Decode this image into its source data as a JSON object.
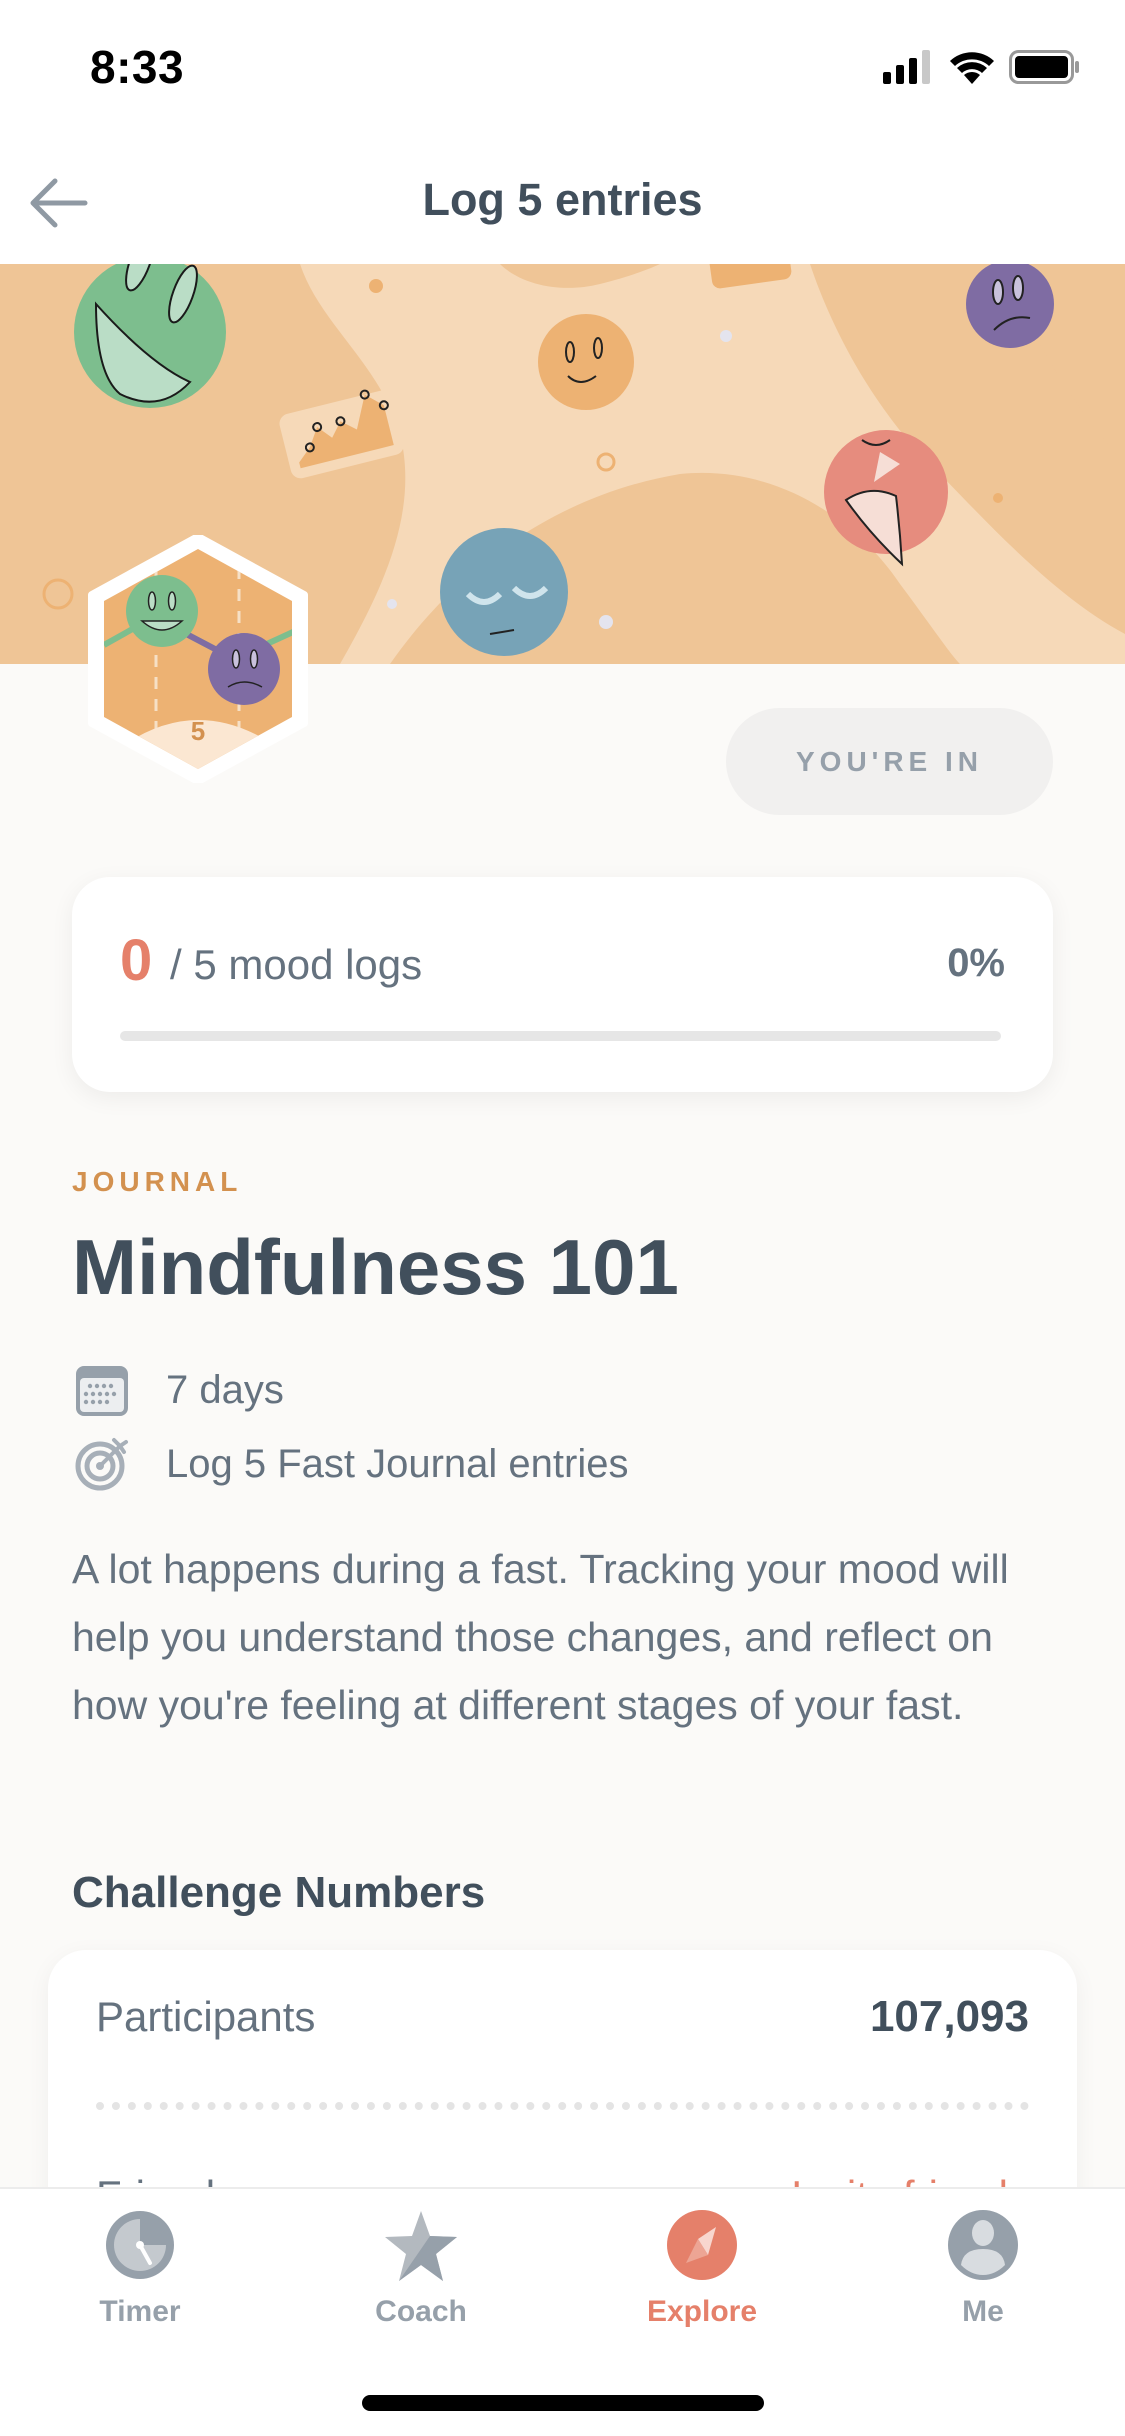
{
  "status_bar": {
    "time": "8:33",
    "icons": [
      "cellular-signal-icon",
      "wifi-icon",
      "battery-icon"
    ]
  },
  "nav": {
    "back_icon": "arrow-left-icon",
    "title": "Log 5 entries"
  },
  "hero": {
    "illustration": "mood-faces-illustration",
    "badge_number": "5"
  },
  "join_button": {
    "label": "YOU'RE IN"
  },
  "progress": {
    "current": "0",
    "label": "/ 5 mood logs",
    "percent_text": "0%",
    "fraction": 0,
    "accent_color": "#E5806A"
  },
  "challenge": {
    "category": "JOURNAL",
    "title": "Mindfulness 101",
    "meta": [
      {
        "icon": "calendar-icon",
        "text": "7 days"
      },
      {
        "icon": "target-icon",
        "text": "Log 5 Fast Journal entries"
      }
    ],
    "description": "A lot happens during a fast. Tracking your mood will help you understand those changes, and reflect on how you're feeling at different stages of your fast."
  },
  "numbers": {
    "section_title": "Challenge Numbers",
    "rows": [
      {
        "label": "Participants",
        "value": "107,093"
      },
      {
        "label": "Friends",
        "link": "Invite friends"
      }
    ]
  },
  "tab_bar": {
    "tabs": [
      {
        "label": "Timer",
        "icon": "timer-icon",
        "active": false
      },
      {
        "label": "Coach",
        "icon": "star-icon",
        "active": false
      },
      {
        "label": "Explore",
        "icon": "compass-icon",
        "active": true
      },
      {
        "label": "Me",
        "icon": "profile-icon",
        "active": false
      }
    ],
    "active_color": "#E5806A",
    "inactive_color": "#96A0AA"
  }
}
